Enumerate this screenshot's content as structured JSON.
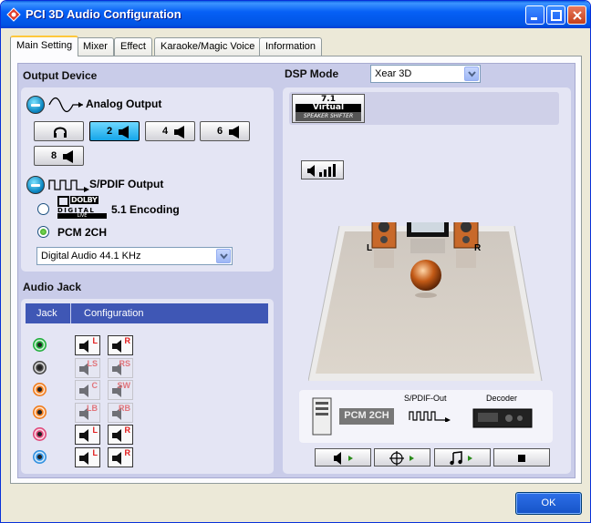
{
  "window": {
    "title": "PCI 3D Audio Configuration"
  },
  "tabs": [
    {
      "label": "Main Setting",
      "active": true
    },
    {
      "label": "Mixer"
    },
    {
      "label": "Effect"
    },
    {
      "label": "Karaoke/Magic Voice"
    },
    {
      "label": "Information"
    }
  ],
  "output_device": {
    "title": "Output Device",
    "analog_label": "Analog Output",
    "speaker_buttons": [
      {
        "label": "",
        "icon": "headphones-icon"
      },
      {
        "label": "2",
        "icon": "speaker-icon",
        "selected": true
      },
      {
        "label": "4",
        "icon": "speaker-icon"
      },
      {
        "label": "6",
        "icon": "speaker-icon"
      },
      {
        "label": "8",
        "icon": "speaker-icon"
      }
    ],
    "spdif_label": "S/PDIF Output",
    "encoding_label": "5.1 Encoding",
    "pcm_label": "PCM 2CH",
    "selected_mode": "PCM 2CH",
    "sample_rate": "Digital Audio 44.1 KHz",
    "dolby_logo": {
      "line1": "DOLBY",
      "line2": "DIGITAL",
      "line3": "LIVE"
    }
  },
  "audio_jack": {
    "title": "Audio Jack",
    "col_jack": "Jack",
    "col_config": "Configuration",
    "rows": [
      {
        "color": "#1fae3a",
        "left": "L",
        "right": "R",
        "enabled": true
      },
      {
        "color": "#444444",
        "left": "LS",
        "right": "RS",
        "enabled": false
      },
      {
        "color": "#f07a18",
        "left": "C",
        "right": "SW",
        "enabled": false
      },
      {
        "color": "#f07a18",
        "left": "LB",
        "right": "RB",
        "enabled": false
      },
      {
        "color": "#e0477a",
        "left": "L",
        "right": "R",
        "enabled": true
      },
      {
        "color": "#2e8fe0",
        "left": "L",
        "right": "R",
        "enabled": true
      }
    ]
  },
  "dsp": {
    "title": "DSP Mode",
    "mode": "Xear 3D",
    "virtual_btn": {
      "line1": "7.1",
      "line2": "Virtual",
      "line3": "SPEAKER SHIFTER"
    },
    "stage_left": "L",
    "stage_right": "R"
  },
  "signal_chain": {
    "spdif_out": "S/PDIF-Out",
    "decoder": "Decoder",
    "pcm": "PCM 2CH"
  },
  "buttons": {
    "ok": "OK"
  },
  "colors": {
    "accent": "#3f57b5",
    "panel": "#c9cce9",
    "selected": "#15a5e8"
  }
}
